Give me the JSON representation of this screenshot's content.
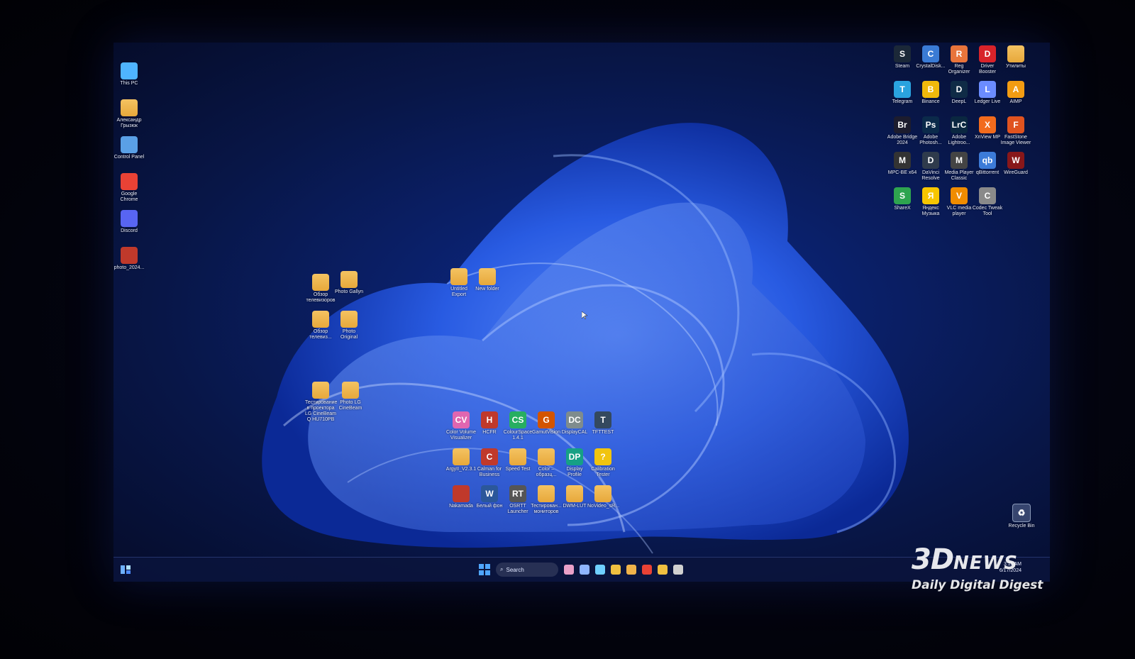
{
  "left_icons": [
    {
      "label": "This PC",
      "icon": "monitor-icon",
      "color": "#4fb4ff"
    },
    {
      "label": "Александр Грызюк",
      "icon": "user-folder-icon",
      "color": "#f0b34a"
    },
    {
      "label": "Control Panel",
      "icon": "control-panel-icon",
      "color": "#5aa0e6"
    },
    {
      "label": "Google Chrome",
      "icon": "chrome-icon",
      "color": "#e94235"
    },
    {
      "label": "Discord",
      "icon": "discord-icon",
      "color": "#5865f2"
    },
    {
      "label": "photo_2024...",
      "icon": "image-file-icon",
      "color": "#c0392b"
    }
  ],
  "right_icons": [
    {
      "label": "Steam",
      "icon": "steam-icon",
      "color": "#1b2838",
      "text": "S"
    },
    {
      "label": "CrystalDisk...",
      "icon": "crystaldisk-icon",
      "color": "#3a7bd5",
      "text": "C"
    },
    {
      "label": "Reg Organizer",
      "icon": "reg-organizer-icon",
      "color": "#e8743b",
      "text": "R"
    },
    {
      "label": "Driver Booster",
      "icon": "driver-booster-icon",
      "color": "#d8232a",
      "text": "D"
    },
    {
      "label": "Утилиты",
      "icon": "folder-icon",
      "color": "#f0b34a",
      "text": ""
    },
    {
      "label": "Telegram",
      "icon": "telegram-icon",
      "color": "#2aa3df",
      "text": "T"
    },
    {
      "label": "Binance",
      "icon": "binance-icon",
      "color": "#f0b90b",
      "text": "B"
    },
    {
      "label": "DeepL",
      "icon": "deepl-icon",
      "color": "#0f2b46",
      "text": "D"
    },
    {
      "label": "Ledger Live",
      "icon": "ledger-icon",
      "color": "#6b8cff",
      "text": "L"
    },
    {
      "label": "AIMP",
      "icon": "aimp-icon",
      "color": "#f39c12",
      "text": "A"
    },
    {
      "label": "Adobe Bridge 2024",
      "icon": "adobe-bridge-icon",
      "color": "#1c1c2e",
      "text": "Br"
    },
    {
      "label": "Adobe Photosh...",
      "icon": "photoshop-icon",
      "color": "#0b2a4a",
      "text": "Ps"
    },
    {
      "label": "Adobe Lightroo...",
      "icon": "lightroom-icon",
      "color": "#0a2740",
      "text": "LrC"
    },
    {
      "label": "XnView MP",
      "icon": "xnview-icon",
      "color": "#f26b1d",
      "text": "X"
    },
    {
      "label": "FastStone Image Viewer",
      "icon": "faststone-icon",
      "color": "#e0531f",
      "text": "F"
    },
    {
      "label": "MPC-BE x64",
      "icon": "mpc-be-icon",
      "color": "#333333",
      "text": "M"
    },
    {
      "label": "DaVinci Resolve",
      "icon": "davinci-icon",
      "color": "#2f3b4c",
      "text": "D"
    },
    {
      "label": "Media Player Classic",
      "icon": "mpc-icon",
      "color": "#444444",
      "text": "M"
    },
    {
      "label": "qBittorrent",
      "icon": "qbittorrent-icon",
      "color": "#3c7bd8",
      "text": "qb"
    },
    {
      "label": "WireGuard",
      "icon": "wireguard-icon",
      "color": "#88171a",
      "text": "W"
    },
    {
      "label": "ShareX",
      "icon": "sharex-icon",
      "color": "#2ea44f",
      "text": "S"
    },
    {
      "label": "Яндекс Музыка",
      "icon": "yandex-music-icon",
      "color": "#f7c600",
      "text": "Я"
    },
    {
      "label": "VLC media player",
      "icon": "vlc-icon",
      "color": "#f08c00",
      "text": "V"
    },
    {
      "label": "Codec Tweak Tool",
      "icon": "codec-tool-icon",
      "color": "#8a8a8a",
      "text": "C"
    }
  ],
  "middle_folders": [
    {
      "label": "Обзор телевизоров",
      "icon": "folder-icon"
    },
    {
      "label": "Photo Gallyn",
      "icon": "folder-icon"
    },
    {
      "label": "Untitled Export",
      "icon": "folder-icon"
    },
    {
      "label": "New folder",
      "icon": "folder-icon"
    },
    {
      "label": "Обзор телевиз...",
      "icon": "folder-icon"
    },
    {
      "label": "Photo Original",
      "icon": "folder-icon"
    },
    {
      "label": "Тестирование в проектора LG CineBeam Q HU710PB",
      "icon": "folder-icon"
    },
    {
      "label": "Photo LG CineBeam",
      "icon": "folder-icon"
    }
  ],
  "center_icons": [
    {
      "label": "Color Volume Visualizer",
      "icon": "color-volume-icon",
      "color": "#e066b0",
      "text": "CV"
    },
    {
      "label": "HCFR",
      "icon": "hcfr-icon",
      "color": "#c0392b",
      "text": "H"
    },
    {
      "label": "ColourSpace 1.4.1",
      "icon": "colourspace-icon",
      "color": "#27ae60",
      "text": "CS"
    },
    {
      "label": "GamutVision",
      "icon": "gamutvision-icon",
      "color": "#d35400",
      "text": "G"
    },
    {
      "label": "DisplayCAL",
      "icon": "displaycal-icon",
      "color": "#7f8c8d",
      "text": "DC"
    },
    {
      "label": "TFTTEST",
      "icon": "tfttest-icon",
      "color": "#34495e",
      "text": "T"
    },
    {
      "label": "ArgyII_V2.3.1",
      "icon": "folder-icon",
      "color": "#f0b34a",
      "text": ""
    },
    {
      "label": "Calman for Business",
      "icon": "calman-icon",
      "color": "#c0392b",
      "text": "C"
    },
    {
      "label": "Speed Test",
      "icon": "folder-icon",
      "color": "#f0b34a",
      "text": ""
    },
    {
      "label": "Color – образц...",
      "icon": "folder-icon",
      "color": "#f0b34a",
      "text": ""
    },
    {
      "label": "Display Profile",
      "icon": "display-profile-icon",
      "color": "#16a085",
      "text": "DP"
    },
    {
      "label": "Calibration Tester",
      "icon": "question-icon",
      "color": "#f1c40f",
      "text": "?"
    },
    {
      "label": "Nakamada",
      "icon": "image-file-icon",
      "color": "#c0392b",
      "text": ""
    },
    {
      "label": "Белый фон",
      "icon": "word-doc-icon",
      "color": "#2b579a",
      "text": "W"
    },
    {
      "label": "OSRTT Launcher",
      "icon": "osrtt-icon",
      "color": "#555555",
      "text": "RT"
    },
    {
      "label": "Тестирован... мониторов",
      "icon": "folder-icon",
      "color": "#f0b34a",
      "text": ""
    },
    {
      "label": "DWM-LUT",
      "icon": "folder-icon",
      "color": "#f0b34a",
      "text": ""
    },
    {
      "label": "NoVideo_sR...",
      "icon": "folder-icon",
      "color": "#f0b34a",
      "text": ""
    }
  ],
  "recycle_bin": {
    "label": "Recycle Bin",
    "icon": "recycle-bin-icon"
  },
  "taskbar": {
    "search_placeholder": "Search",
    "time": "3:11 AM",
    "date": "6/17/2024",
    "apps": [
      "#e9a0c8",
      "#8fb5ff",
      "#6fd0ff",
      "#f0c040",
      "#f0b34a",
      "#e94235",
      "#f0c040",
      "#d0d0d0"
    ]
  },
  "watermark": {
    "brand_3d": "3D",
    "brand_news": "NEWS",
    "tagline": "Daily Digital Digest"
  }
}
